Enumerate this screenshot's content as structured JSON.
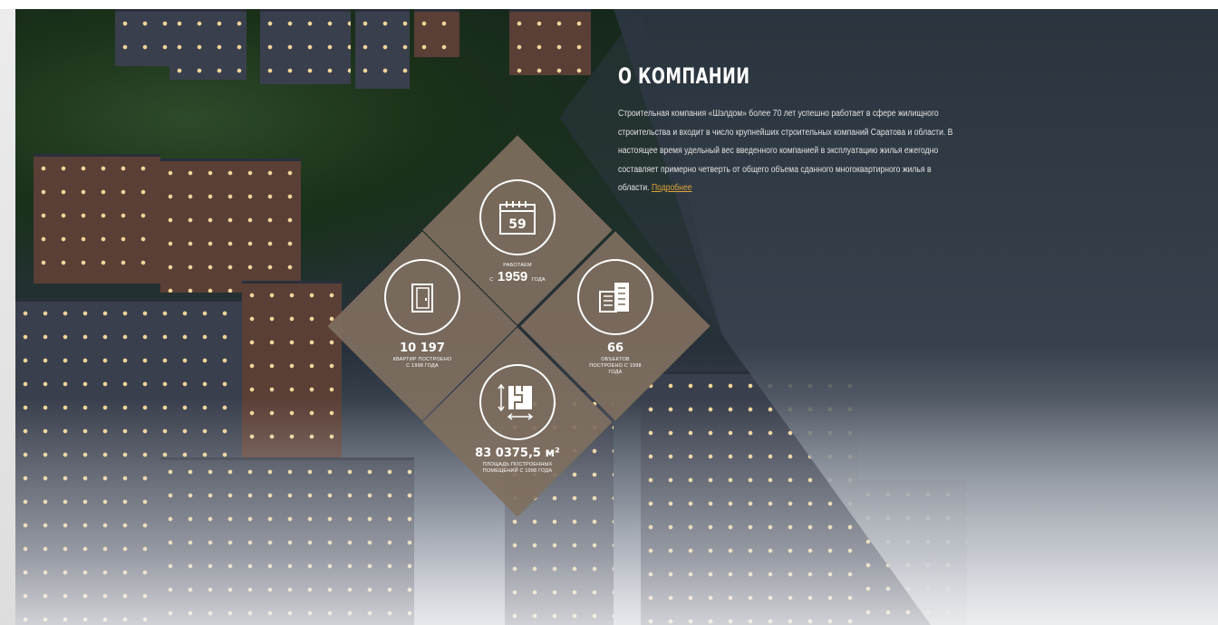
{
  "about": {
    "title": "О КОМПАНИИ",
    "text": "Строительная компания «Шэлдом» более 70 лет успешно работает в сфере жилищного строительства и входит в число крупнейших строительных компаний Саратова и области. В настоящее время удельный вес введенного компанией в эксплуатацию жилья ежегодно составляет примерно четверть от общего объема сданного многоквартирного жилья в области.",
    "more_link": "Подробнее"
  },
  "stats": {
    "years": {
      "caption_top": "работаем",
      "caption_prefix": "с",
      "year": "1959",
      "caption_suffix": "года",
      "calendar_number": "59",
      "icon": "calendar-icon"
    },
    "apartments": {
      "value": "10 197",
      "caption": "квартир построено с 1998 года",
      "icon": "door-icon"
    },
    "objects": {
      "value": "66",
      "caption": "объектов построено с 1998 года",
      "icon": "building-icon"
    },
    "area": {
      "value": "83 0375,5 м²",
      "caption": "площадь построенных помещений с 1998 года",
      "icon": "floorplan-icon"
    }
  },
  "colors": {
    "diamond": "#7f6f5f",
    "link": "#e0a43a"
  }
}
